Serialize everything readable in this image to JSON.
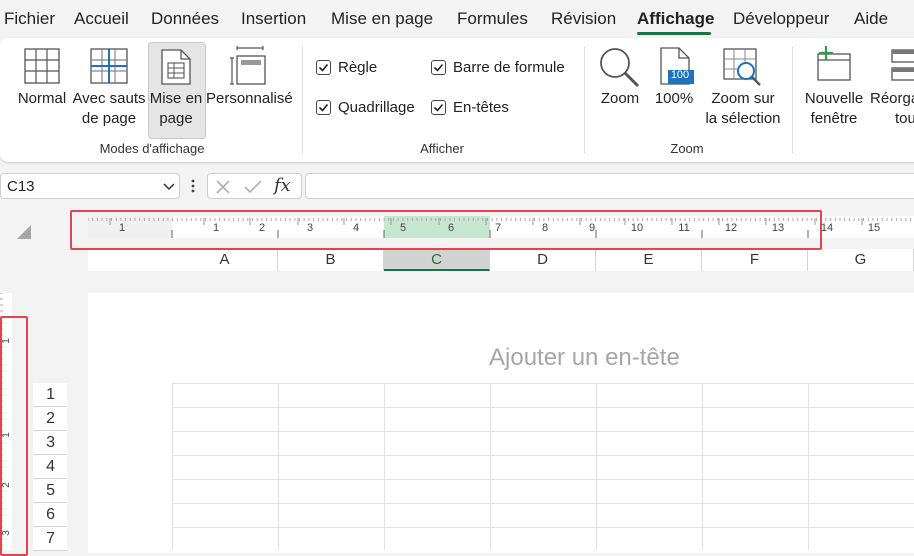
{
  "menu": {
    "items": [
      "Fichier",
      "Accueil",
      "Données",
      "Insertion",
      "Mise en page",
      "Formules",
      "Révision",
      "Affichage",
      "Développeur",
      "Aide"
    ],
    "active": "Affichage"
  },
  "ribbon": {
    "modes": {
      "normal": "Normal",
      "page_break_1": "Avec sauts",
      "page_break_2": "de page",
      "page_layout_1": "Mise en",
      "page_layout_2": "page",
      "custom": "Personnalisé",
      "group_label": "Modes d'affichage"
    },
    "show": {
      "ruler": "Règle",
      "formula_bar": "Barre de formule",
      "gridlines": "Quadrillage",
      "headings": "En-têtes",
      "group_label": "Afficher"
    },
    "zoom": {
      "zoom": "Zoom",
      "zoom100": "100%",
      "zoom100_icon_text": "100",
      "zoom_sel_1": "Zoom sur",
      "zoom_sel_2": "la sélection",
      "group_label": "Zoom"
    },
    "window": {
      "new_1": "Nouvelle",
      "new_2": "fenêtre",
      "arrange_1": "Réorga",
      "arrange_2": "tou"
    }
  },
  "formula_bar": {
    "name_box": "C13",
    "fx": "fx",
    "value": ""
  },
  "ruler": {
    "labels": [
      "1",
      "1",
      "2",
      "3",
      "4",
      "5",
      "6",
      "7",
      "8",
      "9",
      "10",
      "11",
      "12",
      "13",
      "14",
      "15"
    ]
  },
  "columns": [
    "A",
    "B",
    "C",
    "D",
    "E",
    "F",
    "G"
  ],
  "selected_column": "C",
  "rows": [
    "1",
    "2",
    "3",
    "4",
    "5",
    "6",
    "7"
  ],
  "vertical_ruler_labels": [
    "1",
    "1",
    "2",
    "3"
  ],
  "page_header_placeholder": "Ajouter un en-tête",
  "colors": {
    "accent": "#1e7145",
    "highlight": "#e0464e",
    "selected_ruler": "#c6e6d2"
  }
}
